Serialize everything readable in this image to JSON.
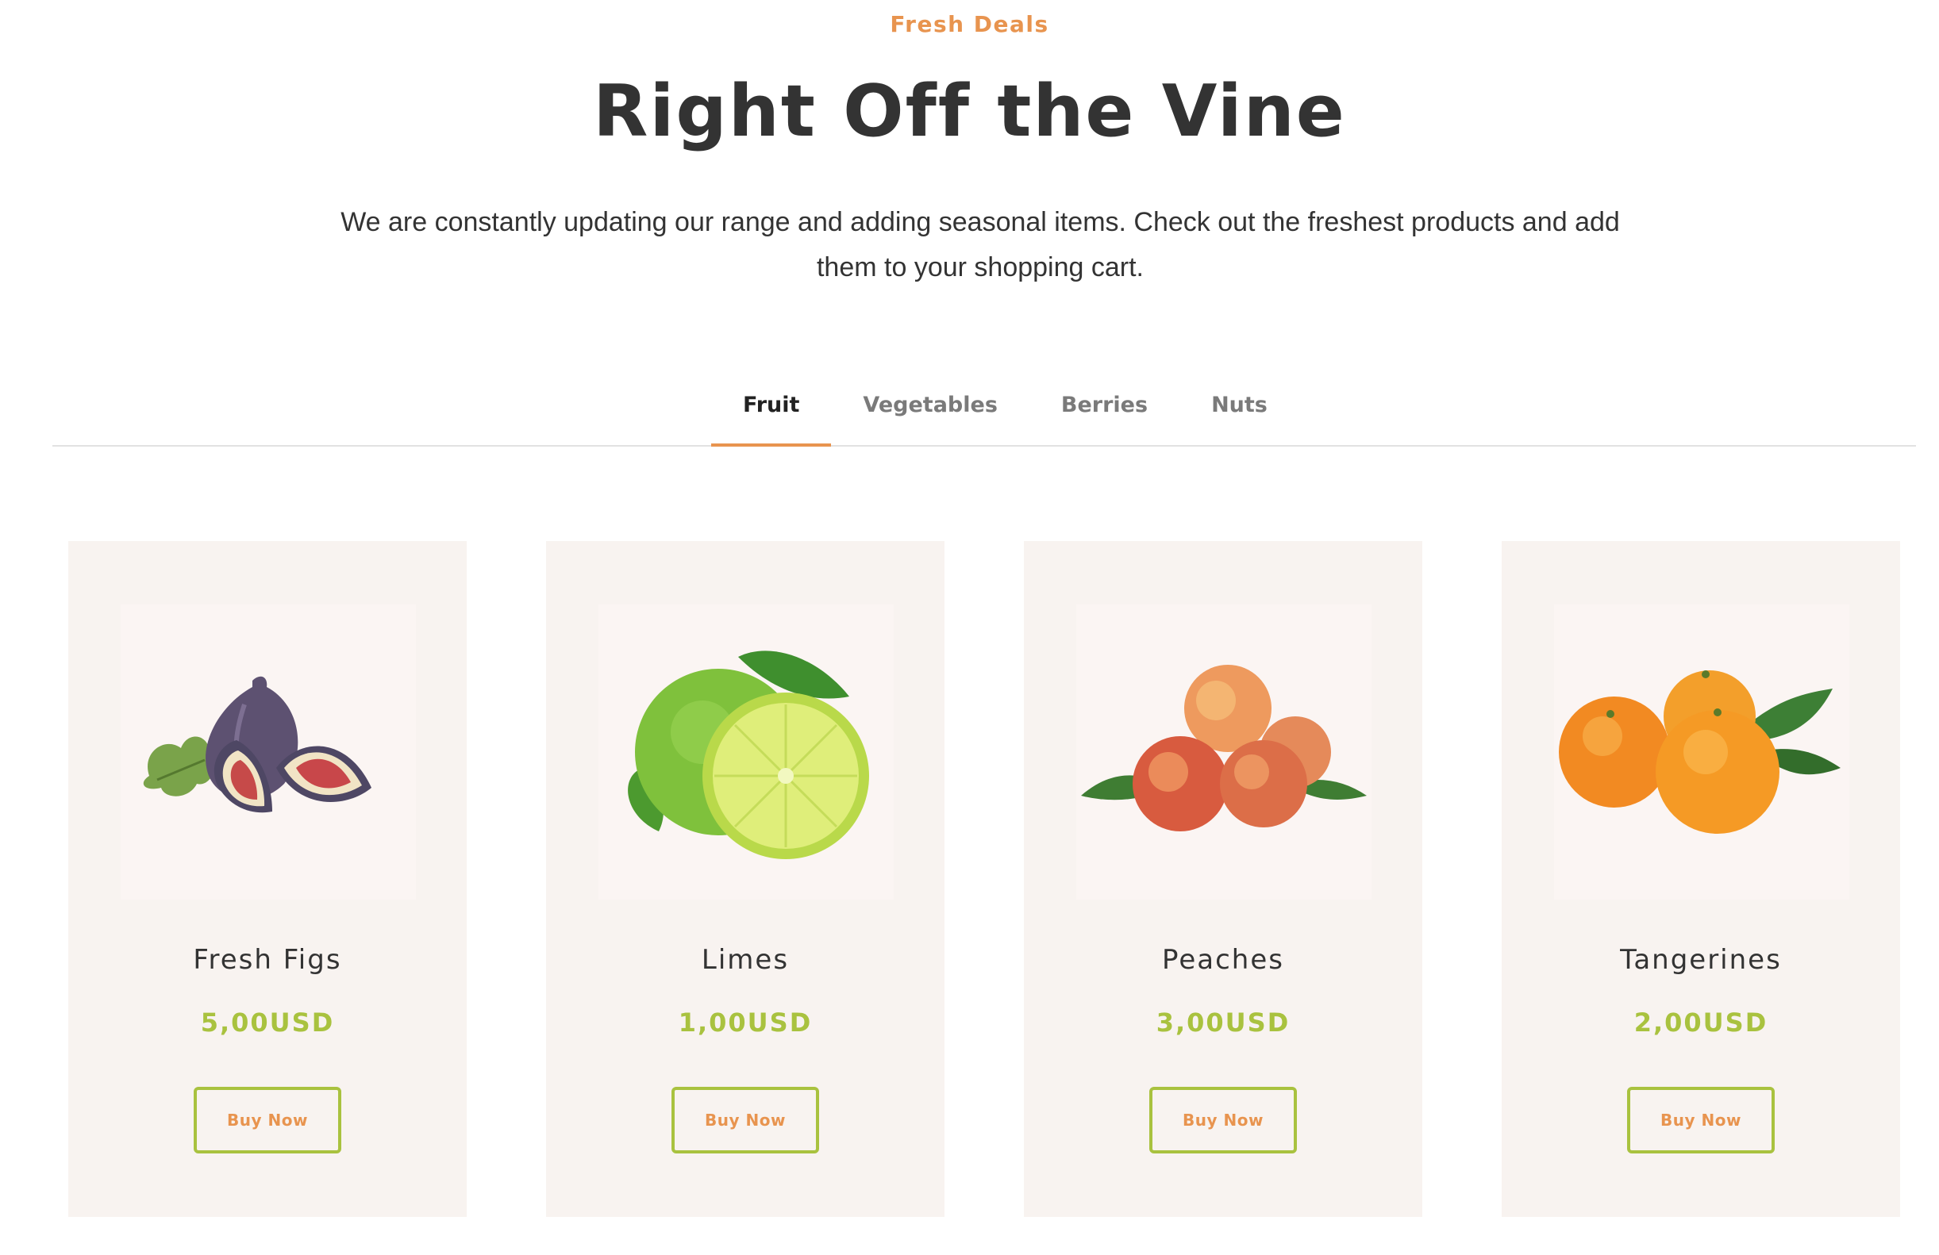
{
  "section": {
    "eyebrow": "Fresh Deals",
    "title": "Right Off the Vine",
    "intro": "We are constantly updating our range and adding seasonal items. Check out the freshest products and add them to your shopping cart."
  },
  "tabs": [
    {
      "label": "Fruit",
      "active": true
    },
    {
      "label": "Vegetables",
      "active": false
    },
    {
      "label": "Berries",
      "active": false
    },
    {
      "label": "Nuts",
      "active": false
    }
  ],
  "products": [
    {
      "name": "Fresh Figs",
      "price": "5,00USD",
      "button": "Buy Now",
      "image": "figs-image"
    },
    {
      "name": "Limes",
      "price": "1,00USD",
      "button": "Buy Now",
      "image": "limes-image"
    },
    {
      "name": "Peaches",
      "price": "3,00USD",
      "button": "Buy Now",
      "image": "peaches-image"
    },
    {
      "name": "Tangerines",
      "price": "2,00USD",
      "button": "Buy Now",
      "image": "tangerines-image"
    }
  ],
  "colors": {
    "accent": "#e8944f",
    "price": "#a9c23f",
    "card_bg": "#f8f3f0",
    "heading": "#333333"
  }
}
